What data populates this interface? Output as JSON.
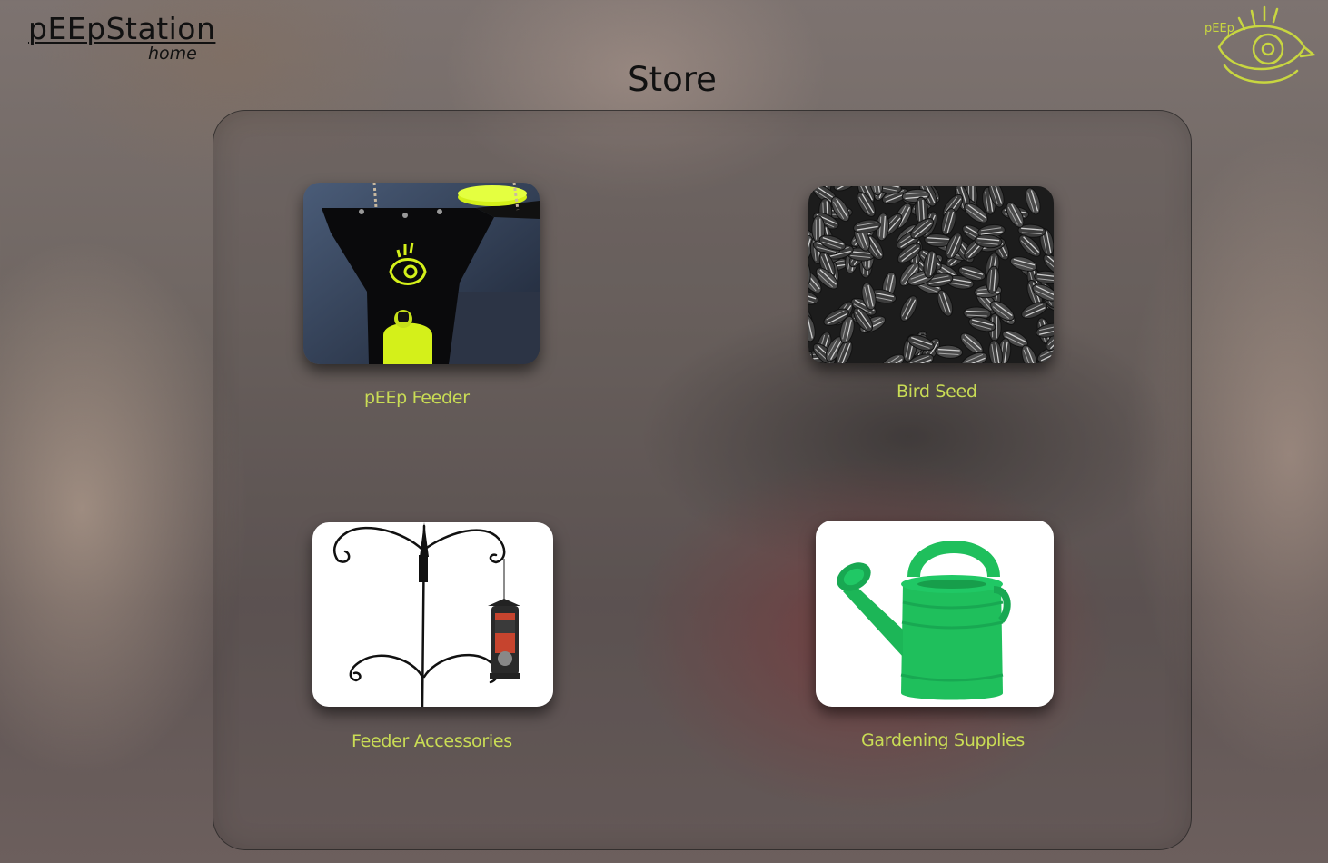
{
  "header": {
    "site_title": "pEEpStation",
    "home_link": "home",
    "page_title": "Store",
    "logo_text": "pEEp",
    "logo_icon": "eye-logo-icon"
  },
  "products": [
    {
      "label": "pEEp Feeder",
      "image": "peep-feeder-image"
    },
    {
      "label": "Bird Seed",
      "image": "bird-seed-image"
    },
    {
      "label": "Feeder Accessories",
      "image": "feeder-accessories-image"
    },
    {
      "label": "Gardening Supplies",
      "image": "gardening-supplies-image"
    }
  ],
  "colors": {
    "caption": "#c9dc55",
    "logo": "#c8d640",
    "accent_yellow": "#d4f01a",
    "watering_can_green": "#1fbf5c"
  }
}
